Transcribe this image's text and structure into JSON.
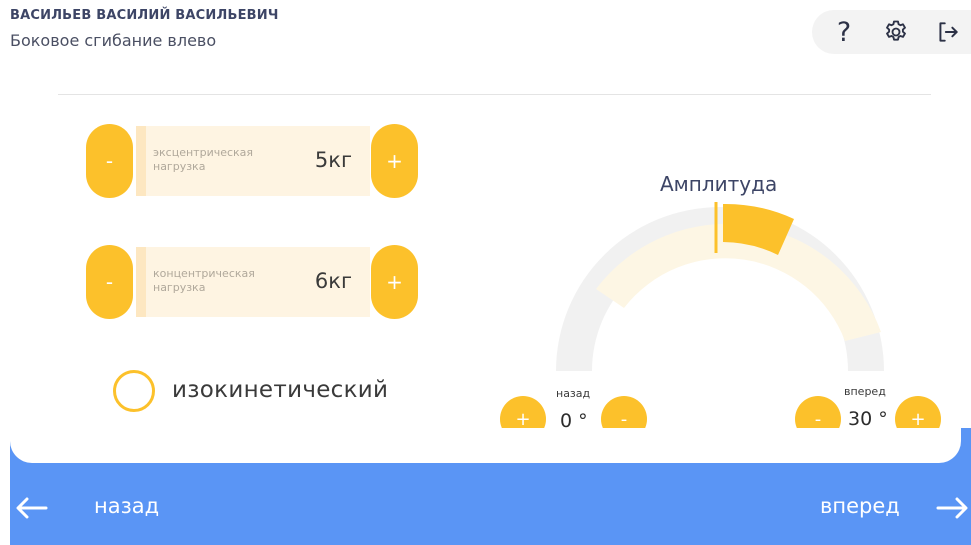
{
  "header": {
    "patient_name": "ВАСИЛЬЕВ ВАСИЛИЙ ВАСИЛЬЕВИЧ",
    "exercise_name": "Боковое сгибание влево",
    "help_glyph": "?",
    "icons": [
      "help-icon",
      "settings-gear-icon",
      "logout-icon"
    ]
  },
  "loads": {
    "eccentric": {
      "label": "эксцентрическая нагрузка",
      "value": "5кг",
      "minus": "-",
      "plus": "+"
    },
    "concentric": {
      "label": "концентрическая нагрузка",
      "value": "6кг",
      "minus": "-",
      "plus": "+"
    }
  },
  "isokinetic": {
    "label": "изокинетический",
    "checked": false
  },
  "amplitude": {
    "title": "Амплитуда",
    "back": {
      "caption": "назад",
      "value": "0 °",
      "plus": "+",
      "minus": "-"
    },
    "forward": {
      "caption": "вперед",
      "value": "30 °",
      "plus": "+",
      "minus": "-"
    }
  },
  "navigation": {
    "back_label": "назад",
    "forward_label": "вперед"
  },
  "colors": {
    "accent_yellow": "#fcc12b",
    "panel_beige": "#fef4e2",
    "bar_blue": "#5a95f5",
    "gauge_track": "#f1f1f1",
    "gauge_range": "#fdf6e4"
  }
}
